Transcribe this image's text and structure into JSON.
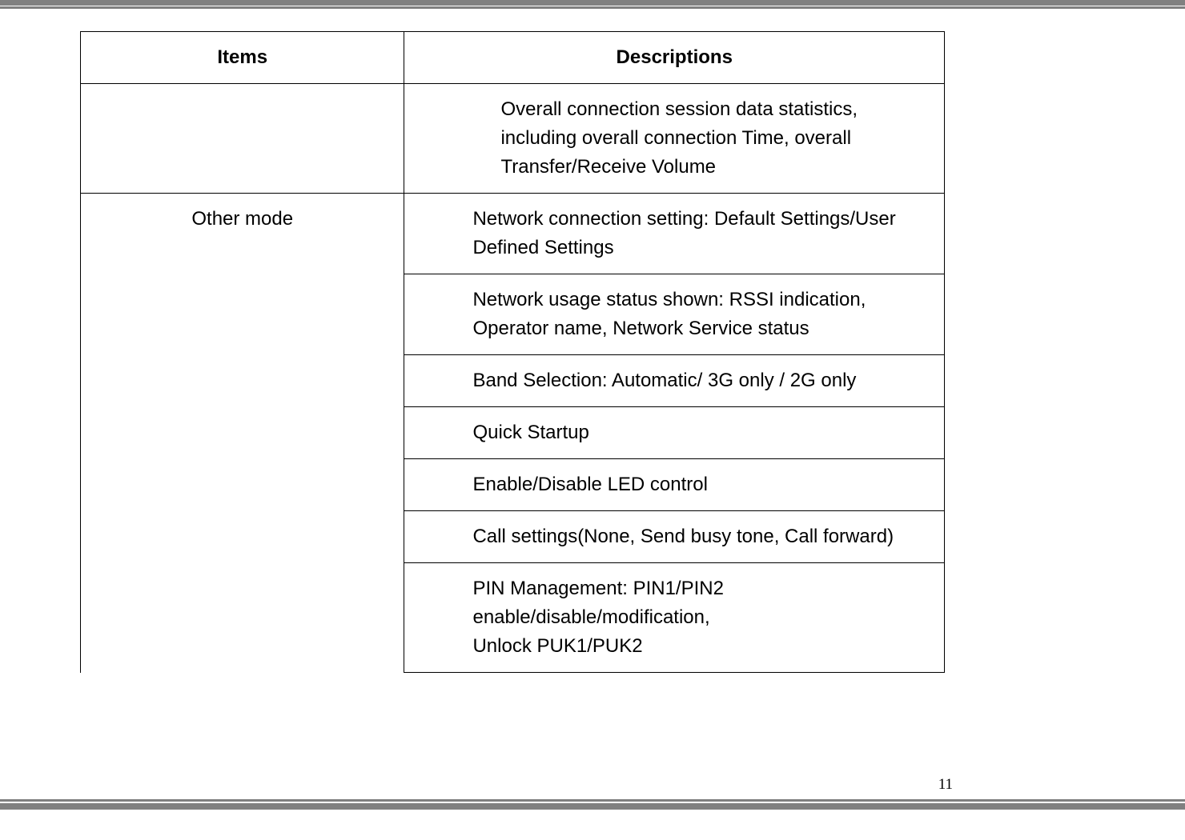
{
  "page_number": "11",
  "table": {
    "headers": {
      "items": "Items",
      "descriptions": "Descriptions"
    },
    "rows": [
      {
        "item": "",
        "description": "Overall connection session data statistics, including overall connection Time, overall Transfer/Receive Volume"
      },
      {
        "item": "Other mode",
        "descriptions": [
          "Network connection setting: Default Settings/User Defined Settings",
          "Network usage status shown: RSSI indication, Operator name, Network Service status",
          "Band Selection: Automatic/ 3G only / 2G only",
          "Quick Startup",
          "Enable/Disable LED control",
          "Call settings(None, Send busy tone, Call forward)",
          "PIN Management: PIN1/PIN2 enable/disable/modification,",
          "Unlock PUK1/PUK2"
        ]
      }
    ]
  }
}
